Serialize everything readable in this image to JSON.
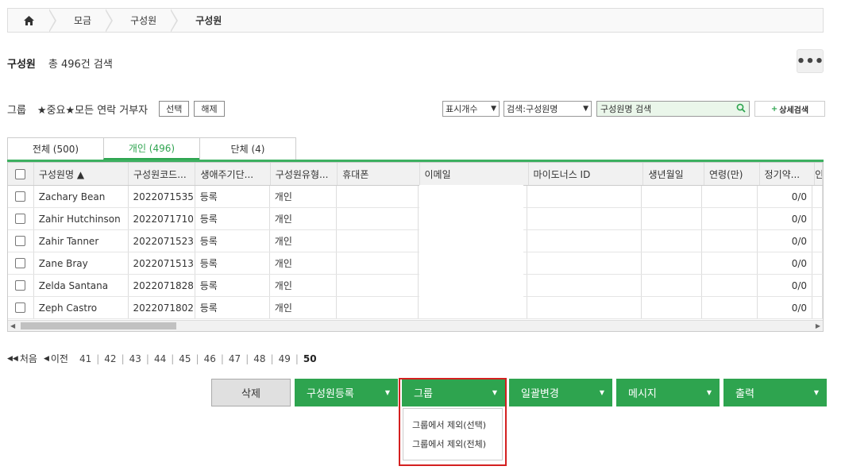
{
  "breadcrumb": {
    "items": [
      "모금",
      "구성원",
      "구성원"
    ]
  },
  "title": "구성원",
  "count_text": "총 496건 검색",
  "more_label": "•••",
  "group": {
    "label": "그룹",
    "name": "★중요★모든 연락 거부자",
    "select_label": "선택",
    "release_label": "해제"
  },
  "search": {
    "display_count": "표시개수",
    "field": "검색:구성원명",
    "placeholder": "구성원명 검색",
    "detail_label": "상세검색",
    "detail_prefix": "+"
  },
  "tabs": [
    {
      "label": "전체 (500)",
      "active": false
    },
    {
      "label": "개인 (496)",
      "active": true
    },
    {
      "label": "단체 (4)",
      "active": false
    }
  ],
  "columns": [
    "구성원명 ▲",
    "구성원코드...",
    "생애주기단...",
    "구성원유형...",
    "휴대폰",
    "이메일",
    "마이도너스 ID",
    "생년월일",
    "연령(만)",
    "정기약...",
    "인"
  ],
  "rows": [
    {
      "name": "Zachary Bean",
      "code": "2022071535",
      "lifecycle": "등록",
      "type": "개인",
      "regular": "0/0"
    },
    {
      "name": "Zahir Hutchinson",
      "code": "2022071710",
      "lifecycle": "등록",
      "type": "개인",
      "regular": "0/0"
    },
    {
      "name": "Zahir Tanner",
      "code": "2022071523",
      "lifecycle": "등록",
      "type": "개인",
      "regular": "0/0"
    },
    {
      "name": "Zane Bray",
      "code": "2022071513",
      "lifecycle": "등록",
      "type": "개인",
      "regular": "0/0"
    },
    {
      "name": "Zelda Santana",
      "code": "2022071828",
      "lifecycle": "등록",
      "type": "개인",
      "regular": "0/0"
    },
    {
      "name": "Zeph Castro",
      "code": "2022071802",
      "lifecycle": "등록",
      "type": "개인",
      "regular": "0/0"
    }
  ],
  "pager": {
    "first": "처음",
    "prev": "이전",
    "pages": [
      "41",
      "42",
      "43",
      "44",
      "45",
      "46",
      "47",
      "48",
      "49"
    ],
    "current": "50"
  },
  "actions": {
    "delete": "삭제",
    "register": "구성원등록",
    "group": "그룹",
    "bulk": "일괄변경",
    "message": "메시지",
    "print": "출력"
  },
  "group_menu": [
    "그룹에서 제외(선택)",
    "그룹에서 제외(전체)"
  ],
  "colors": {
    "accent": "#2ea44f",
    "highlight": "#d42020"
  }
}
